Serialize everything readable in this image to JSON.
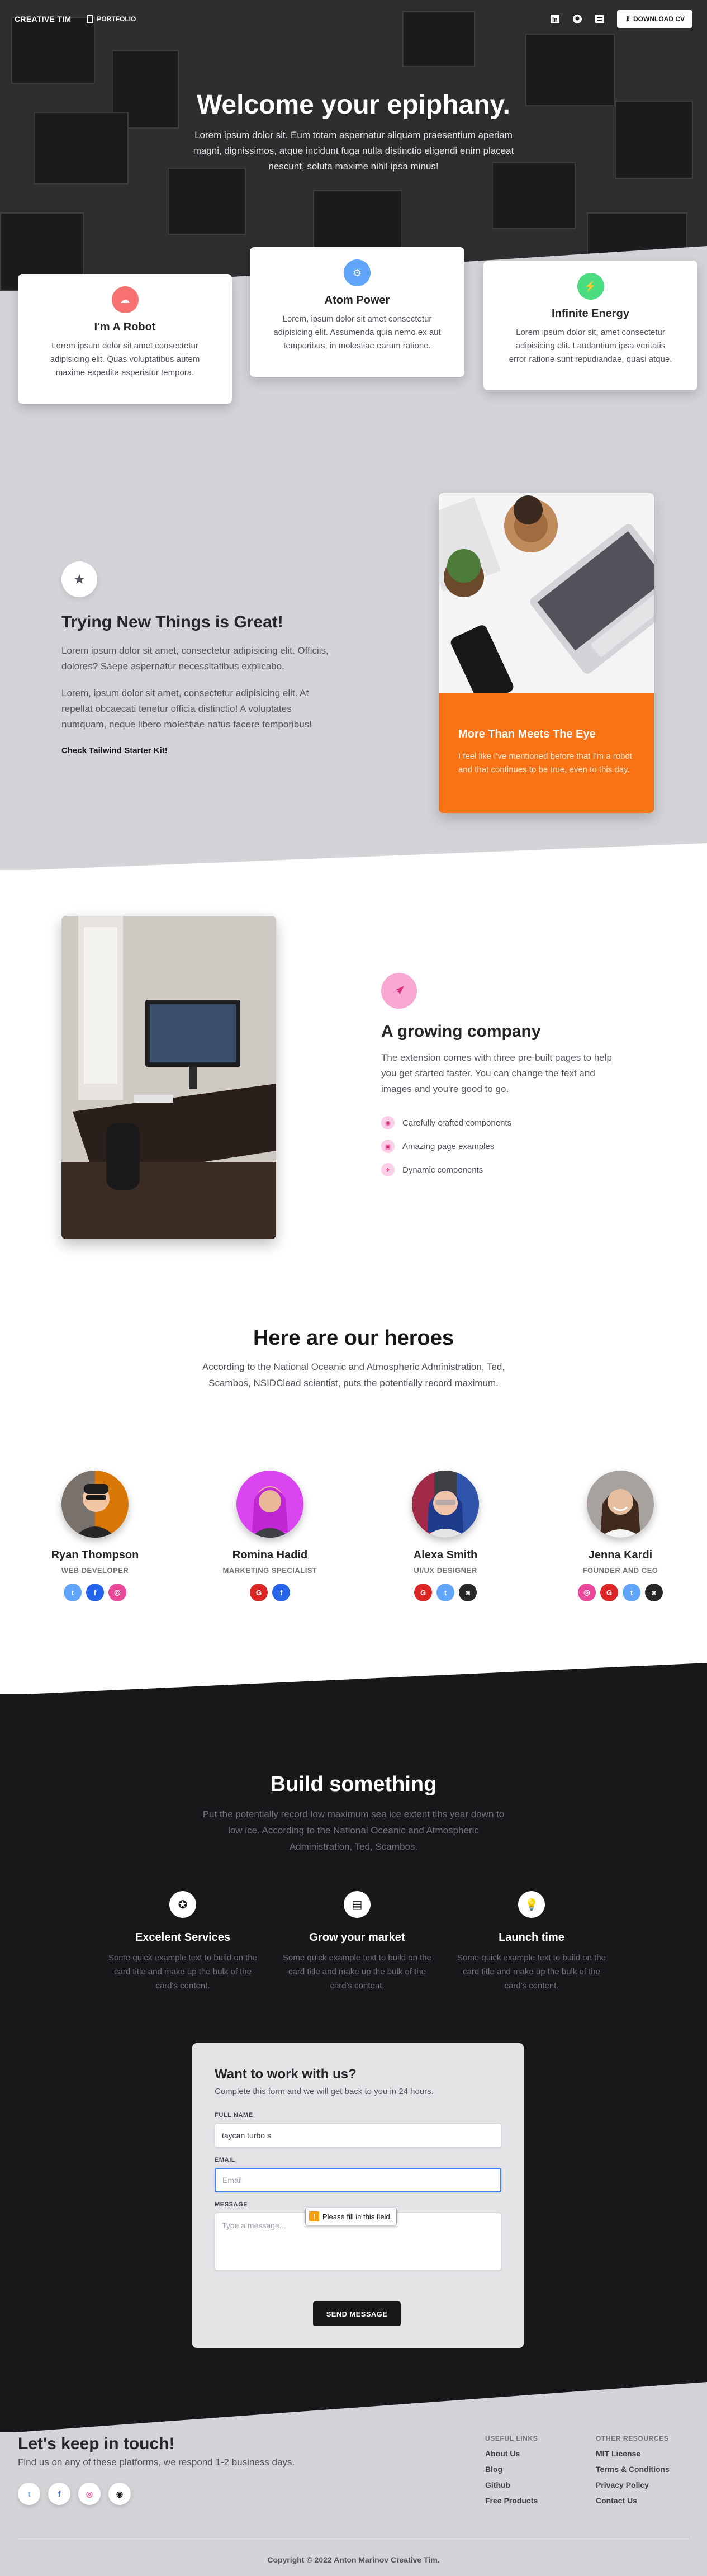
{
  "nav": {
    "brand": "CREATIVE TIM",
    "portfolio": "PORTFOLIO",
    "download": "DOWNLOAD CV"
  },
  "hero": {
    "title": "Welcome your epiphany.",
    "subtitle": "Lorem ipsum dolor sit. Eum totam aspernatur aliquam praesentium aperiam magni, dignissimos, atque incidunt fuga nulla distinctio eligendi enim placeat nescunt, soluta maxime nihil ipsa minus!"
  },
  "features": [
    {
      "title": "I'm A Robot",
      "text": "Lorem ipsum dolor sit amet consectetur adipisicing elit. Quas voluptatibus autem maxime expedita asperiatur tempora.",
      "color": "#f87171",
      "icon": "cloud-icon"
    },
    {
      "title": "Atom Power",
      "text": "Lorem, ipsum dolor sit amet consectetur adipisicing elit. Assumenda quia nemo ex aut temporibus, in molestiae earum ratione.",
      "color": "#60a5fa",
      "icon": "gear-icon"
    },
    {
      "title": "Infinite Energy",
      "text": "Lorem ipsum dolor sit, amet consectetur adipisicing elit. Laudantium ipsa veritatis error ratione sunt repudiandae, quasi atque.",
      "color": "#4ade80",
      "icon": "bolt-icon"
    }
  ],
  "trying": {
    "title": "Trying New Things is Great!",
    "p1": "Lorem ipsum dolor sit amet, consectetur adipisicing elit. Officiis, dolores? Saepe aspernatur necessitatibus explicabo.",
    "p2": "Lorem, ipsum dolor sit amet, consectetur adipisicing elit. At repellat obcaecati tenetur officia distinctio! A voluptates numquam, neque libero molestiae natus facere temporibus!",
    "link": "Check Tailwind Starter Kit!",
    "card_title": "More Than Meets The Eye",
    "card_text": "I feel like I've mentioned before that I'm a robot and that continues to be true, even to this day."
  },
  "growing": {
    "title": "A growing company",
    "text": "The extension comes with three pre-built pages to help you get started faster. You can change the text and images and you're good to go.",
    "items": [
      "Carefully crafted components",
      "Amazing page examples",
      "Dynamic components"
    ]
  },
  "team": {
    "title": "Here are our heroes",
    "subtitle": "According to the National Oceanic and Atmospheric Administration, Ted, Scambos, NSIDClead scientist, puts the potentially record maximum.",
    "members": [
      {
        "name": "Ryan Thompson",
        "role": "WEB DEVELOPER"
      },
      {
        "name": "Romina Hadid",
        "role": "MARKETING SPECIALIST"
      },
      {
        "name": "Alexa Smith",
        "role": "UI/UX DESIGNER"
      },
      {
        "name": "Jenna Kardi",
        "role": "FOUNDER AND CEO"
      }
    ]
  },
  "build": {
    "title": "Build something",
    "subtitle": "Put the potentially record low maximum sea ice extent tihs year down to low ice. According to the National Oceanic and Atmospheric Administration, Ted, Scambos.",
    "services": [
      {
        "title": "Excelent Services",
        "text": "Some quick example text to build on the card title and make up the bulk of the card's content.",
        "icon": "medal-icon"
      },
      {
        "title": "Grow your market",
        "text": "Some quick example text to build on the card title and make up the bulk of the card's content.",
        "icon": "chart-icon"
      },
      {
        "title": "Launch time",
        "text": "Some quick example text to build on the card title and make up the bulk of the card's content.",
        "icon": "lightbulb-icon"
      }
    ]
  },
  "form": {
    "title": "Want to work with us?",
    "subtitle": "Complete this form and we will get back to you in 24 hours.",
    "name_label": "FULL NAME",
    "name_value": "taycan turbo s",
    "email_label": "EMAIL",
    "email_placeholder": "Email",
    "message_label": "MESSAGE",
    "message_placeholder": "Type a message...",
    "tooltip": "Please fill in this field.",
    "send": "SEND MESSAGE"
  },
  "footer": {
    "title": "Let's keep in touch!",
    "subtitle": "Find us on any of these platforms, we respond 1-2 business days.",
    "useful_title": "USEFUL LINKS",
    "useful": [
      "About Us",
      "Blog",
      "Github",
      "Free Products"
    ],
    "other_title": "OTHER RESOURCES",
    "other": [
      "MIT License",
      "Terms & Conditions",
      "Privacy Policy",
      "Contact Us"
    ],
    "copyright": "Copyright © 2022 Anton Marinov Creative Tim."
  }
}
